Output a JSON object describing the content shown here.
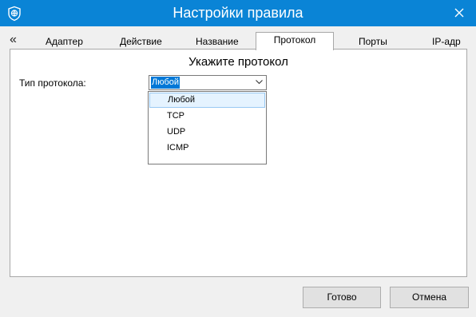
{
  "window": {
    "title": "Настройки правила",
    "icon": "shield-icon",
    "close_icon": "close-icon",
    "accent_color": "#0a84d6"
  },
  "tabs": {
    "scroll_left_icon": "double-chevron-left-icon",
    "items": [
      {
        "label": "Адаптер"
      },
      {
        "label": "Действие"
      },
      {
        "label": "Название"
      },
      {
        "label": "Протокол",
        "selected": true
      },
      {
        "label": "Порты"
      },
      {
        "label": "IP-адр"
      }
    ]
  },
  "main": {
    "heading": "Укажите протокол",
    "protocol_label": "Тип протокола:",
    "protocol_value": "Любой",
    "dropdown_options": [
      "Любой",
      "TCP",
      "UDP",
      "ICMP"
    ],
    "highlighted_option": "Любой"
  },
  "footer": {
    "ok_label": "Готово",
    "cancel_label": "Отмена"
  }
}
